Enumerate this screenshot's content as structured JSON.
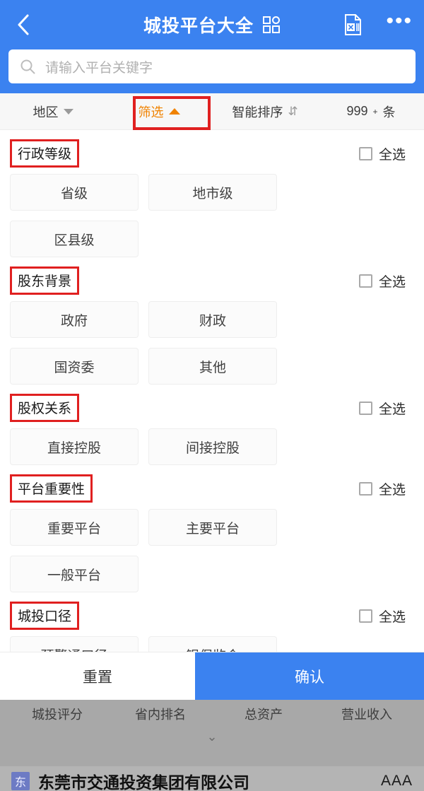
{
  "theme": {
    "brand_blue": "#3b82f0",
    "accent_orange": "#f08200",
    "annotation_red": "#e02020"
  },
  "header": {
    "back_icon": "chevron-left-icon",
    "title": "城投平台大全",
    "grid_icon": "grid-qr-icon",
    "excel_icon": "excel-export-icon",
    "more_icon": "more-dots-icon"
  },
  "search": {
    "placeholder": "请输入平台关键字",
    "icon": "search-icon"
  },
  "filter_bar": {
    "region": {
      "label": "地区",
      "icon": "chevron-down-icon"
    },
    "filter": {
      "label": "筛选",
      "icon": "caret-up-icon",
      "active": true
    },
    "sort": {
      "label": "智能排序",
      "icon": "sort-updown-icon"
    },
    "count": {
      "value": "999",
      "sup": "+",
      "unit": "条"
    }
  },
  "select_all_label": "全选",
  "sections": [
    {
      "title": "行政等级",
      "options": [
        "省级",
        "地市级",
        "区县级"
      ]
    },
    {
      "title": "股东背景",
      "options": [
        "政府",
        "财政",
        "国资委",
        "其他"
      ]
    },
    {
      "title": "股权关系",
      "options": [
        "直接控股",
        "间接控股"
      ]
    },
    {
      "title": "平台重要性",
      "options": [
        "重要平台",
        "主要平台",
        "一般平台"
      ]
    },
    {
      "title": "城投口径",
      "options": [
        "预警通口径",
        "银保监会"
      ]
    }
  ],
  "actions": {
    "reset": "重置",
    "confirm": "确认"
  },
  "background_list": {
    "columns": [
      "城投评分",
      "省内排名",
      "总资产",
      "营业收入"
    ],
    "expand_icon": "chevron-down-icon",
    "row": {
      "badge": "东",
      "name": "东莞市交通投资集团有限公司",
      "rating": "AAA"
    }
  }
}
